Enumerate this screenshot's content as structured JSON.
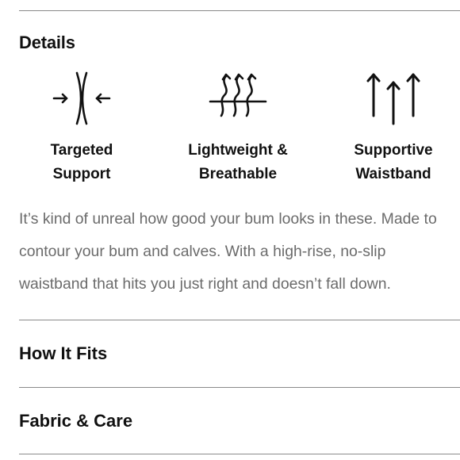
{
  "details": {
    "title": "Details",
    "features": [
      {
        "icon": "compression-arrows-icon",
        "label": "Targeted\nSupport"
      },
      {
        "icon": "breathable-waves-icon",
        "label": "Lightweight &\nBreathable"
      },
      {
        "icon": "upward-arrows-icon",
        "label": "Supportive\nWaistband"
      }
    ],
    "description": "It’s kind of unreal how good your bum looks in these. Made to contour your bum and calves. With a high-rise, no-slip waistband that hits you just right and doesn’t fall down."
  },
  "sections": [
    {
      "title": "How It Fits"
    },
    {
      "title": "Fabric & Care"
    }
  ]
}
